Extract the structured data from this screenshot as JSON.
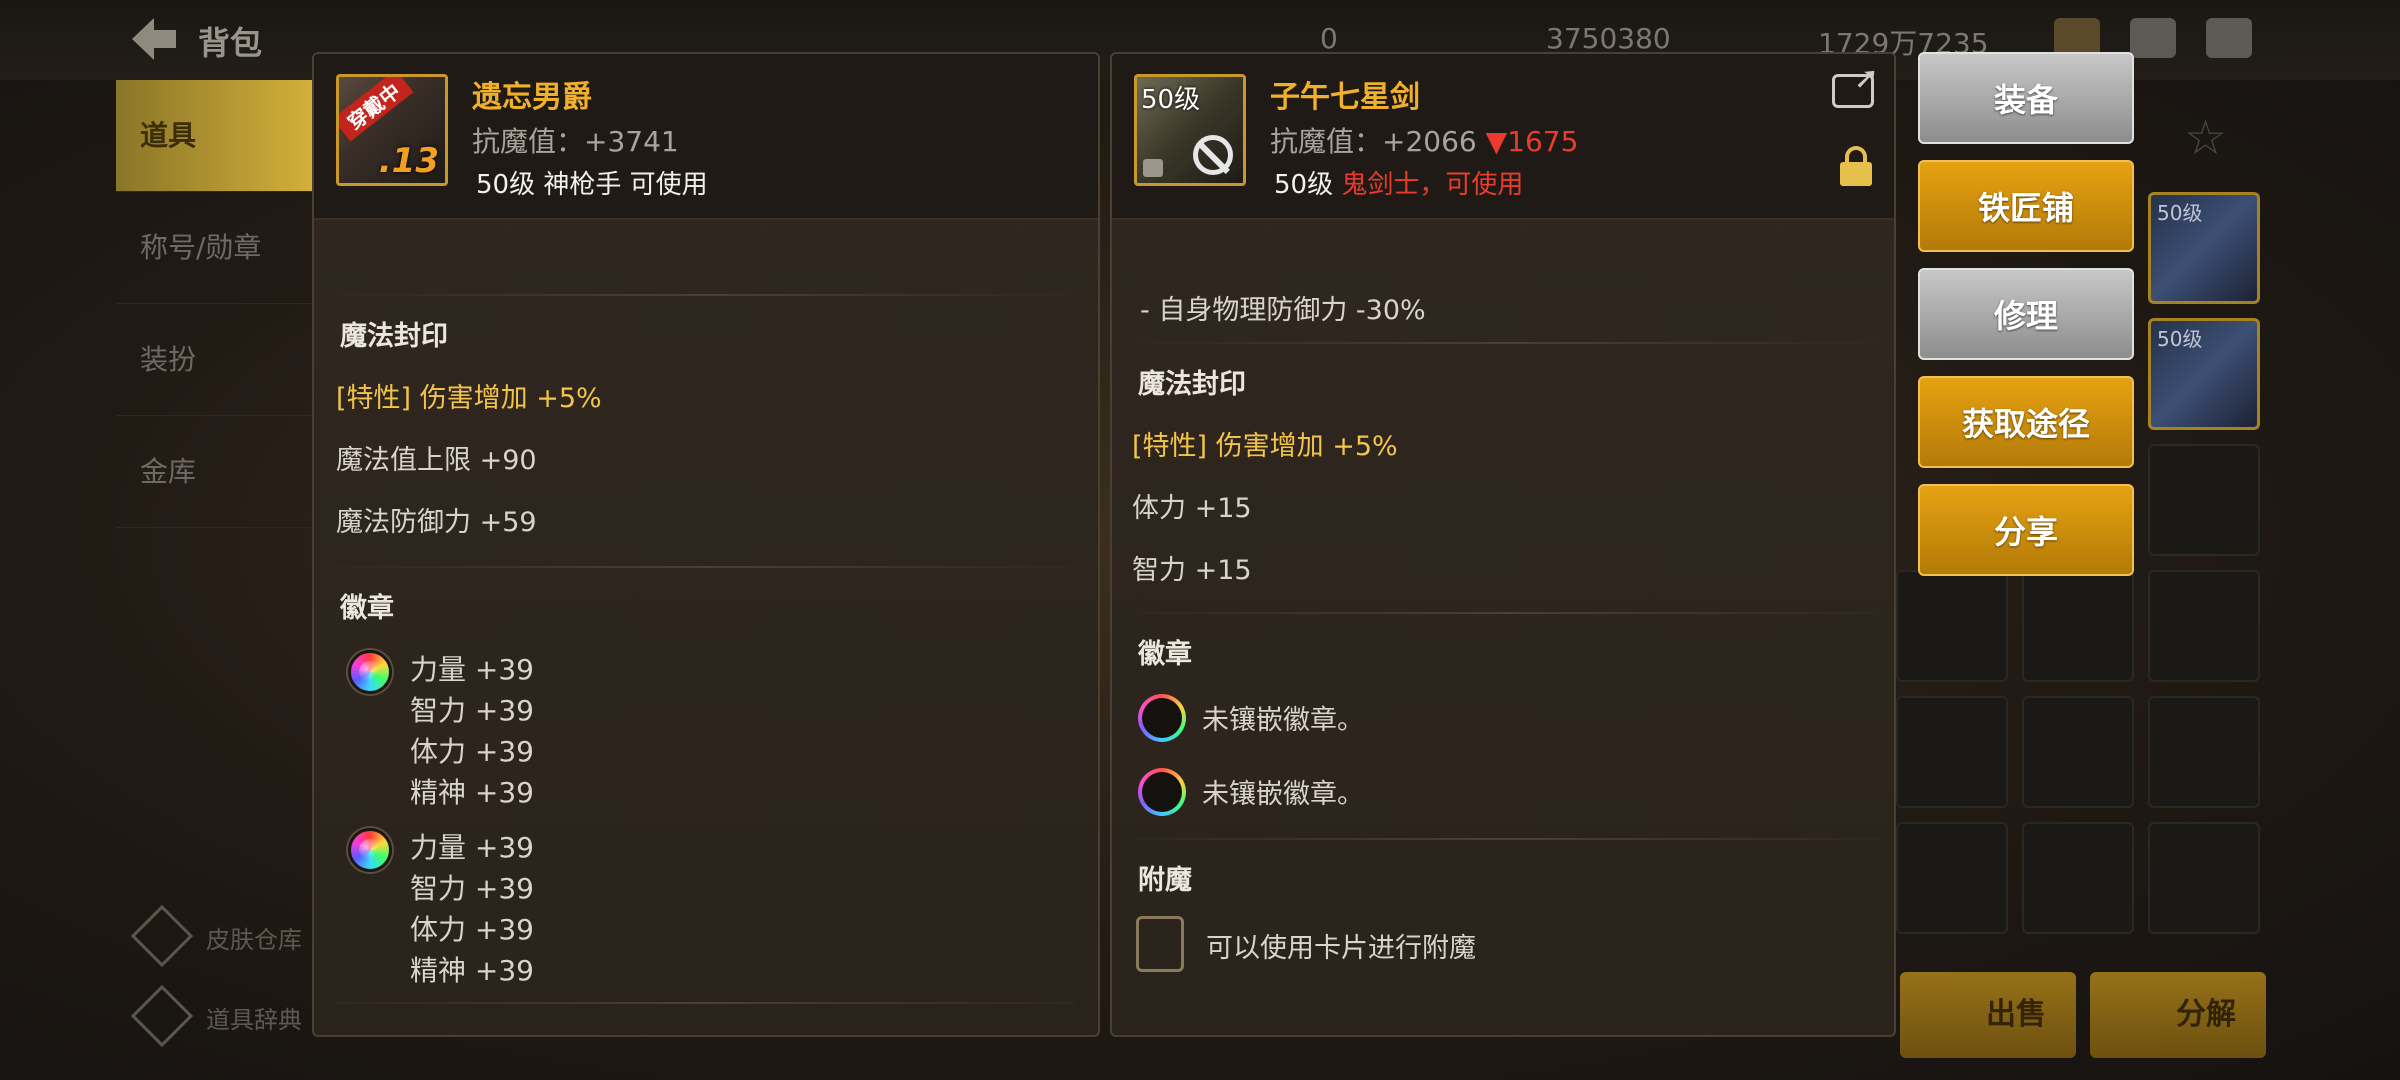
{
  "background": {
    "title": "背包",
    "resources": [
      "0",
      "3750380",
      "1729万7235"
    ],
    "tabs": [
      "道具",
      "称号/勋章",
      "装扮",
      "金库"
    ],
    "links": [
      "皮肤仓库",
      "道具辞典"
    ],
    "grid_levels": [
      "50级",
      "50级"
    ],
    "sell_label": "出售",
    "disassemble_label": "分解"
  },
  "left_item": {
    "name": "遗忘男爵",
    "stat_label": "抗魔值",
    "stat_text": "抗魔值：+3741",
    "requirement": "50级 神枪手 可使用",
    "wearing_tag": "穿戴中",
    "enhance": ".13",
    "sections": {
      "seal_title": "魔法封印",
      "seal_lines": [
        "[特性] 伤害增加 +5%",
        "魔法值上限 +90",
        "魔法防御力 +59"
      ],
      "emblem_title": "徽章",
      "emblems": [
        [
          "力量 +39",
          "智力 +39",
          "体力 +39",
          "精神 +39"
        ],
        [
          "力量 +39",
          "智力 +39",
          "体力 +39",
          "精神 +39"
        ]
      ]
    }
  },
  "right_item": {
    "name": "子午七星剑",
    "level_tag": "50级",
    "stat_text": "抗魔值：+2066",
    "stat_diff": "▼1675",
    "req_level": "50级",
    "req_class": "鬼剑士，可使用",
    "sections": {
      "cut_top": "- 自身物理防御力 -30%",
      "seal_title": "魔法封印",
      "seal_lines": [
        "[特性] 伤害增加 +5%",
        "体力 +15",
        "智力 +15"
      ],
      "emblem_title": "徽章",
      "empty_emblems": [
        "未镶嵌徽章。",
        "未镶嵌徽章。"
      ],
      "enchant_title": "附魔",
      "enchant_text": "可以使用卡片进行附魔"
    }
  },
  "actions": {
    "equip": "装备",
    "blacksmith": "铁匠铺",
    "repair": "修理",
    "obtain": "获取途径",
    "share": "分享"
  },
  "colors": {
    "gold": "#f0b02a",
    "trait": "#f2c44a",
    "negative": "#ea3c2e"
  }
}
